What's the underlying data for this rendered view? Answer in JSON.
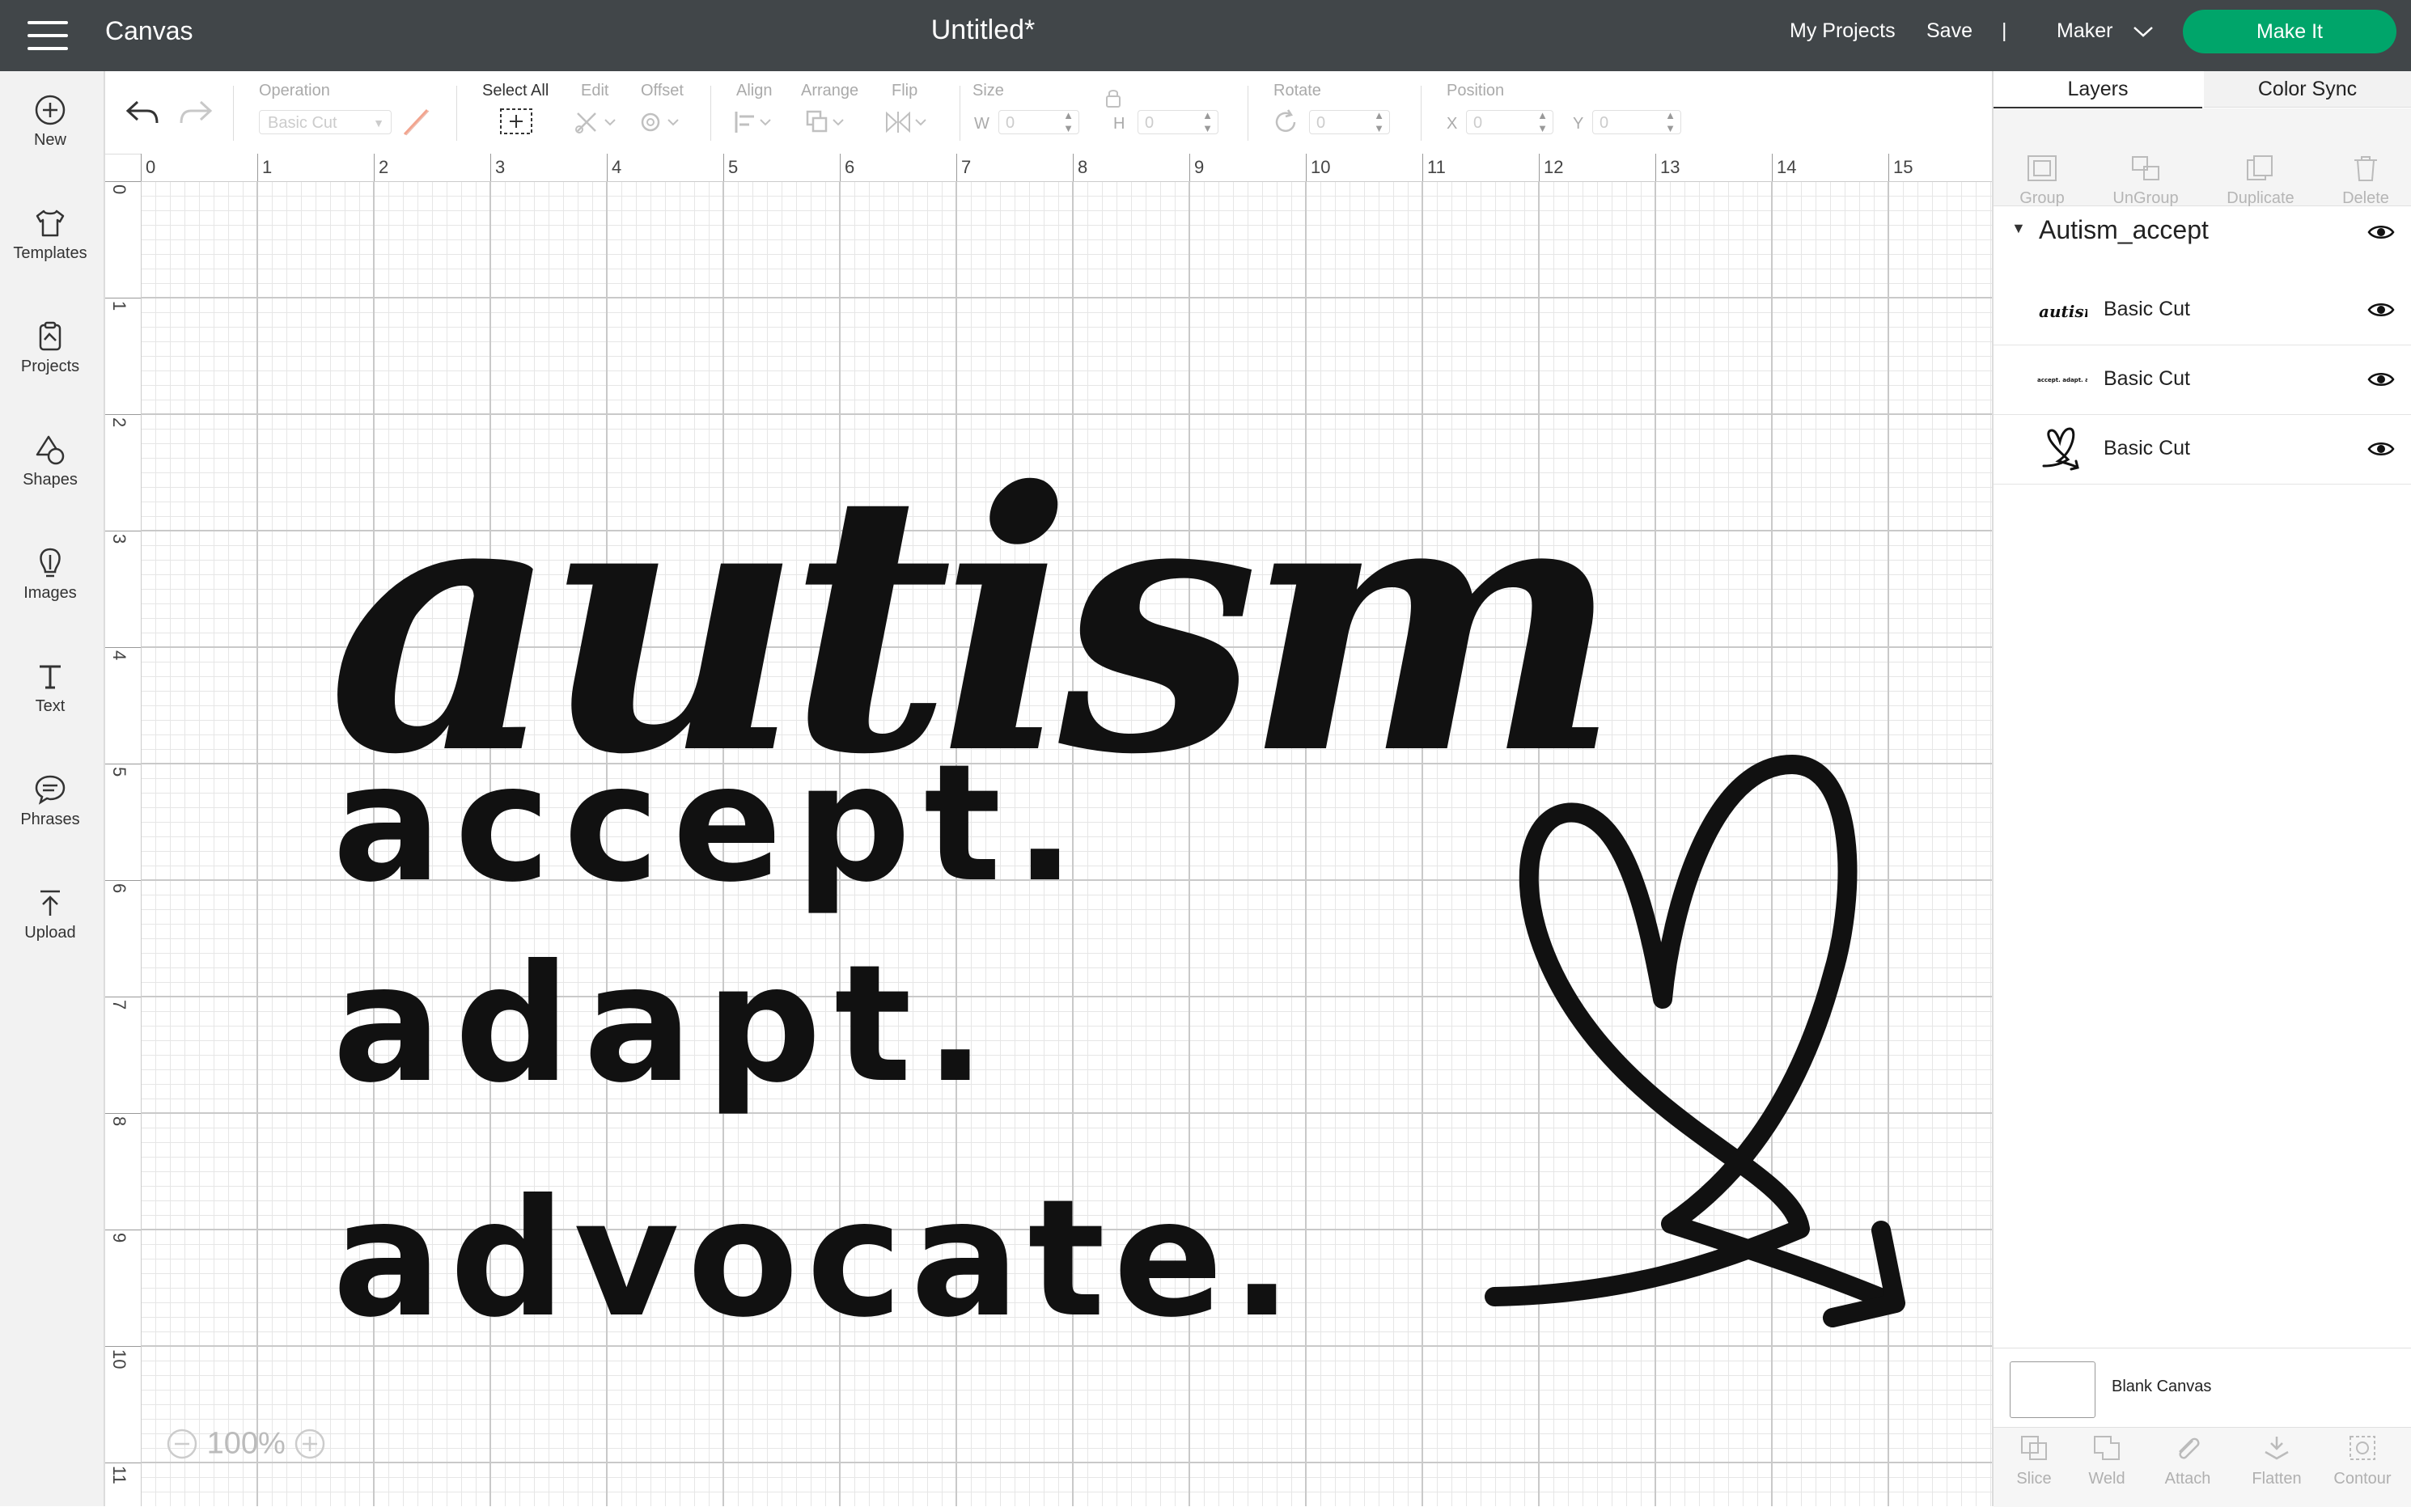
{
  "topbar": {
    "app_title": "Canvas",
    "doc_title": "Untitled*",
    "my_projects": "My Projects",
    "save": "Save",
    "divider": "|",
    "machine": "Maker",
    "make_it": "Make It",
    "make_it_color": "#00a56a"
  },
  "sidebar": {
    "items": [
      {
        "label": "New",
        "icon": "plus-circle-icon"
      },
      {
        "label": "Templates",
        "icon": "shirt-icon"
      },
      {
        "label": "Projects",
        "icon": "projects-icon"
      },
      {
        "label": "Shapes",
        "icon": "shapes-icon"
      },
      {
        "label": "Images",
        "icon": "lightbulb-icon"
      },
      {
        "label": "Text",
        "icon": "text-icon"
      },
      {
        "label": "Phrases",
        "icon": "speech-bubble-icon"
      },
      {
        "label": "Upload",
        "icon": "upload-icon"
      }
    ]
  },
  "toolbar": {
    "operation_label": "Operation",
    "operation_value": "Basic Cut",
    "select_all": "Select All",
    "edit": "Edit",
    "offset": "Offset",
    "align": "Align",
    "arrange": "Arrange",
    "flip": "Flip",
    "size": "Size",
    "w_label": "W",
    "h_label": "H",
    "w_value": "0",
    "h_value": "0",
    "rotate": "Rotate",
    "rotate_value": "0",
    "position": "Position",
    "x_label": "X",
    "y_label": "Y",
    "x_value": "0",
    "y_value": "0"
  },
  "ruler": {
    "horizontal": [
      "0",
      "1",
      "2",
      "3",
      "4",
      "5",
      "6",
      "7",
      "8",
      "9",
      "10",
      "11",
      "12",
      "13",
      "14",
      "15"
    ],
    "vertical": [
      "0",
      "1",
      "2",
      "3",
      "4",
      "5",
      "6",
      "7",
      "8",
      "9",
      "10",
      "11"
    ]
  },
  "canvas": {
    "zoom": "100%",
    "design_text": {
      "line1": "autism",
      "line2": "accept.",
      "line3": "adapt.",
      "line4": "advocate."
    }
  },
  "panel": {
    "tabs": [
      "Layers",
      "Color Sync"
    ],
    "actions": [
      "Group",
      "UnGroup",
      "Duplicate",
      "Delete"
    ],
    "group_name": "Autism_accept",
    "layers": [
      {
        "name": "Basic Cut",
        "thumb": "autism"
      },
      {
        "name": "Basic Cut",
        "thumb": "accept. adapt. advocate."
      },
      {
        "name": "Basic Cut",
        "thumb": "heart-arrow"
      }
    ],
    "blank_canvas": "Blank Canvas",
    "bottom_actions": [
      "Slice",
      "Weld",
      "Attach",
      "Flatten",
      "Contour"
    ]
  }
}
